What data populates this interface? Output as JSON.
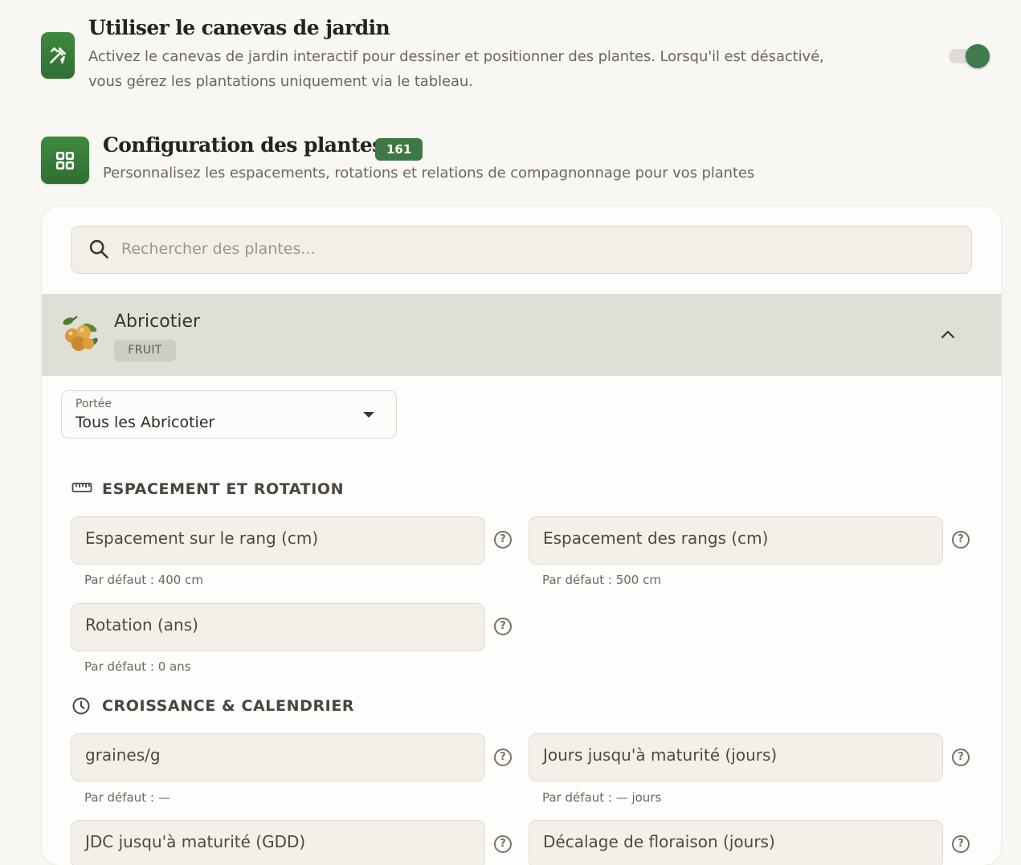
{
  "canvas_setting": {
    "title": "Utiliser le canevas de jardin",
    "description_line1": "Activez le canevas de jardin interactif pour dessiner et positionner des plantes. Lorsqu'il est désactivé,",
    "description_line2": "vous gérez les plantations uniquement via le tableau.",
    "icon": "pencil-ruler-icon",
    "toggle_on": true
  },
  "plant_config": {
    "title": "Configuration des plantes",
    "count": "161",
    "description": "Personnalisez les espacements, rotations et relations de compagnonnage pour vos plantes",
    "icon": "grid-icon"
  },
  "search": {
    "placeholder": "Rechercher des plantes..."
  },
  "plant": {
    "name": "Abricotier",
    "category": "FRUIT",
    "expanded": true
  },
  "scope": {
    "label": "Portée",
    "value": "Tous les Abricotier"
  },
  "spacing_section": {
    "title": "ESPACEMENT ET ROTATION",
    "fields": [
      {
        "label": "Espacement sur le rang (cm)",
        "hint": "Par défaut : 400 cm"
      },
      {
        "label": "Espacement des rangs (cm)",
        "hint": "Par défaut : 500 cm"
      },
      {
        "label": "Rotation (ans)",
        "hint": "Par défaut : 0 ans"
      }
    ]
  },
  "growth_section": {
    "title": "CROISSANCE & CALENDRIER",
    "fields": [
      {
        "label": "graines/g",
        "hint": "Par défaut : —"
      },
      {
        "label": "Jours jusqu'à maturité (jours)",
        "hint": "Par défaut : — jours"
      },
      {
        "label": "JDC jusqu'à maturité (GDD)"
      },
      {
        "label": "Décalage de floraison (jours)"
      }
    ]
  },
  "help_glyph": "?",
  "colors": {
    "accent": "#3d7a43",
    "row_highlight": "#dfdfd8"
  }
}
